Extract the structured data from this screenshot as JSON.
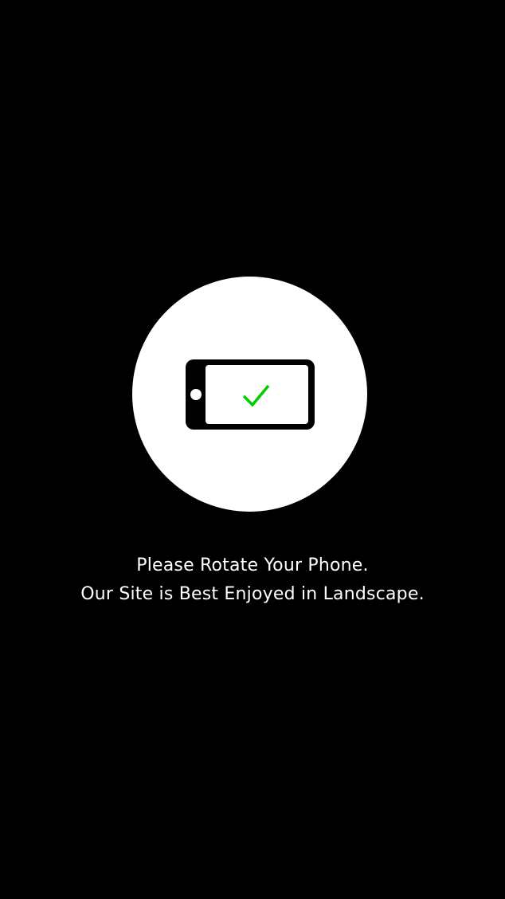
{
  "rotate_prompt": {
    "line1": "Please Rotate Your Phone.",
    "line2": "Our Site is Best Enjoyed in Landscape."
  },
  "icons": {
    "phone": "landscape-phone-icon",
    "check": "checkmark-icon"
  },
  "colors": {
    "background": "#000000",
    "circle": "#ffffff",
    "phone": "#000000",
    "check": "#00cc00",
    "text": "#ffffff"
  }
}
